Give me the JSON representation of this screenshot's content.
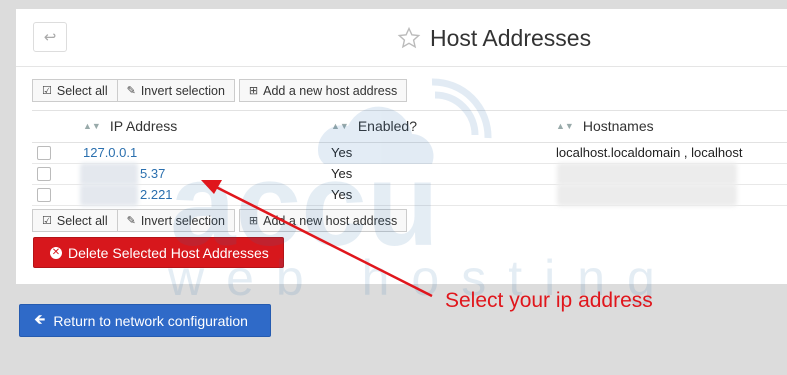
{
  "header": {
    "title": "Host Addresses",
    "back_icon": "return-arrow-icon",
    "star_icon": "star-icon"
  },
  "toolbar": {
    "select_all": "Select all",
    "invert_selection": "Invert selection",
    "add_host": "Add a new host address"
  },
  "table": {
    "columns": [
      "IP Address",
      "Enabled?",
      "Hostnames"
    ],
    "rows": [
      {
        "ip": "127.0.0.1",
        "enabled": "Yes",
        "hostnames": "localhost.localdomain , localhost"
      },
      {
        "ip": "5.37",
        "enabled": "Yes",
        "hostnames": ""
      },
      {
        "ip": "2.221",
        "enabled": "Yes",
        "hostnames": ""
      }
    ]
  },
  "actions": {
    "delete_label": "Delete Selected Host Addresses",
    "return_label": "Return to network configuration"
  },
  "watermark": {
    "brand": "accu",
    "tagline": "web hosting"
  },
  "annotation": {
    "text": "Select your ip address"
  },
  "colors": {
    "delete_red": "#d7171c",
    "return_blue": "#2f6ac8",
    "link_blue": "#2a6fae",
    "annotation_red": "#e0161c"
  }
}
